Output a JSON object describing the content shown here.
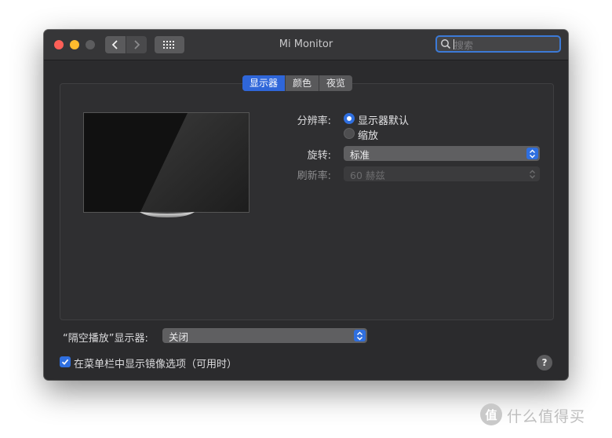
{
  "window": {
    "title": "Mi Monitor",
    "search_placeholder": "搜索",
    "icons": {
      "back": "chevron-left-icon",
      "forward": "chevron-right-icon",
      "show_all": "grid-icon",
      "search": "search-icon"
    }
  },
  "tabs": [
    {
      "label": "显示器",
      "active": true
    },
    {
      "label": "颜色",
      "active": false
    },
    {
      "label": "夜览",
      "active": false
    }
  ],
  "settings": {
    "resolution_label": "分辨率:",
    "resolution_options": [
      {
        "label": "显示器默认",
        "selected": true
      },
      {
        "label": "缩放",
        "selected": false
      }
    ],
    "rotation_label": "旋转:",
    "rotation_value": "标准",
    "refresh_label": "刷新率:",
    "refresh_value": "60 赫兹"
  },
  "airplay": {
    "label": "“隔空播放”显示器:",
    "value": "关闭"
  },
  "mirror_option": {
    "label": "在菜单栏中显示镜像选项（可用时）",
    "checked": true
  },
  "help_label": "?",
  "watermark": {
    "logo": "值",
    "text": "什么值得买"
  },
  "colors": {
    "accent": "#2f6fe0",
    "window_bg": "#2b2b2d",
    "close": "#fe5f57",
    "minimize": "#febc2e"
  }
}
